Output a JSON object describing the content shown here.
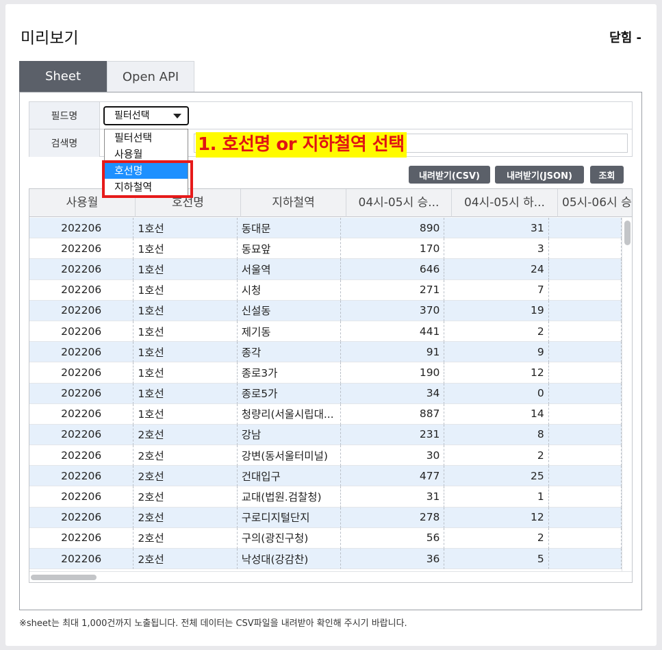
{
  "header": {
    "title": "미리보기",
    "close_label": "닫힘 -"
  },
  "tabs": [
    {
      "label": "Sheet",
      "active": true
    },
    {
      "label": "Open API",
      "active": false
    }
  ],
  "form": {
    "field_label": "필드명",
    "search_label": "검색명",
    "select_value": "필터선택",
    "dropdown_options": [
      "필터선택",
      "사용월",
      "호선명",
      "지하철역"
    ],
    "highlighted_option": "호선명"
  },
  "annotation": {
    "text": "1. 호선명 or 지하철역 선택",
    "color": "#e01414",
    "background": "#fffb00"
  },
  "buttons": {
    "csv": "내려받기(CSV)",
    "json": "내려받기(JSON)",
    "search": "조회"
  },
  "table": {
    "columns": [
      "사용월",
      "호선명",
      "지하철역",
      "04시-05시 승...",
      "04시-05시 하...",
      "05시-06시 승"
    ],
    "rows": [
      [
        "202206",
        "1호선",
        "동대문",
        "890",
        "31"
      ],
      [
        "202206",
        "1호선",
        "동묘앞",
        "170",
        "3"
      ],
      [
        "202206",
        "1호선",
        "서울역",
        "646",
        "24"
      ],
      [
        "202206",
        "1호선",
        "시청",
        "271",
        "7"
      ],
      [
        "202206",
        "1호선",
        "신설동",
        "370",
        "19"
      ],
      [
        "202206",
        "1호선",
        "제기동",
        "441",
        "2"
      ],
      [
        "202206",
        "1호선",
        "종각",
        "91",
        "9"
      ],
      [
        "202206",
        "1호선",
        "종로3가",
        "190",
        "12"
      ],
      [
        "202206",
        "1호선",
        "종로5가",
        "34",
        "0"
      ],
      [
        "202206",
        "1호선",
        "청량리(서울시립대...",
        "887",
        "14"
      ],
      [
        "202206",
        "2호선",
        "강남",
        "231",
        "8"
      ],
      [
        "202206",
        "2호선",
        "강변(동서울터미널)",
        "30",
        "2"
      ],
      [
        "202206",
        "2호선",
        "건대입구",
        "477",
        "25"
      ],
      [
        "202206",
        "2호선",
        "교대(법원.검찰청)",
        "31",
        "1"
      ],
      [
        "202206",
        "2호선",
        "구로디지털단지",
        "278",
        "12"
      ],
      [
        "202206",
        "2호선",
        "구의(광진구청)",
        "56",
        "2"
      ],
      [
        "202206",
        "2호선",
        "낙성대(강감찬)",
        "36",
        "5"
      ]
    ]
  },
  "footnote": "※sheet는 최대 1,000건까지 노출됩니다. 전체 데이터는 CSV파일을 내려받아 확인해 주시기 바랍니다.",
  "colors": {
    "accent": "#5b6069",
    "row_alt": "#e6f0fb",
    "highlight": "#1e90ff"
  }
}
